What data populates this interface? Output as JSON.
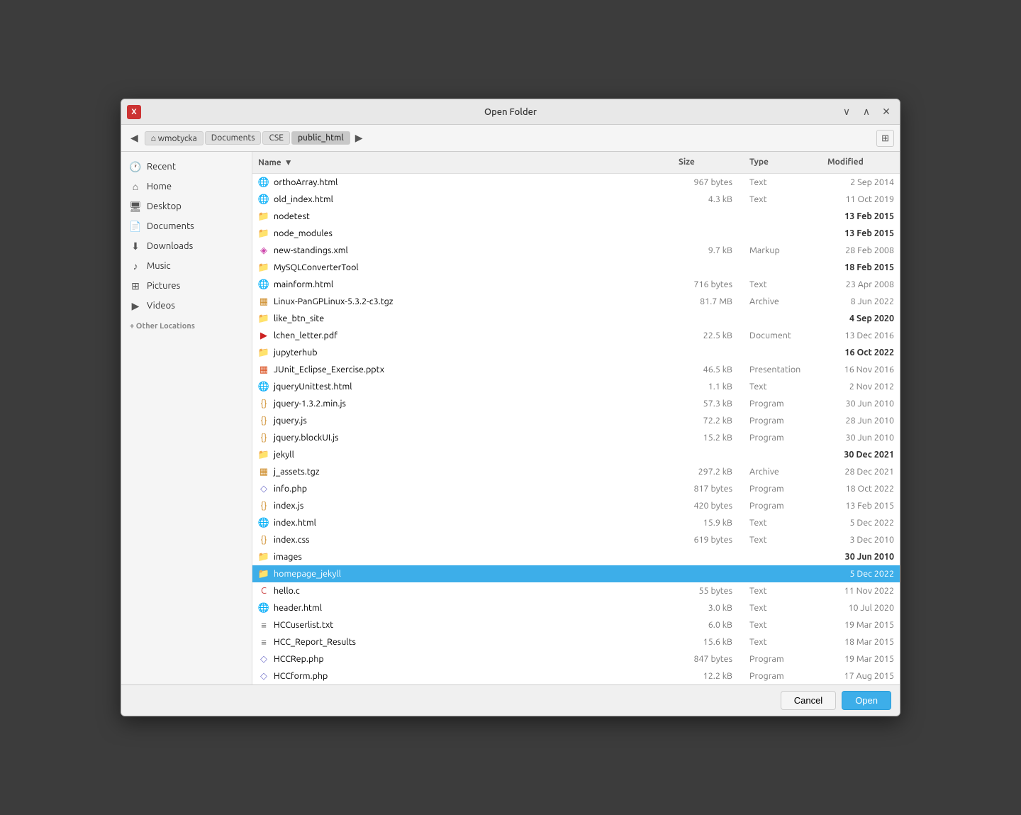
{
  "window": {
    "title": "Open Folder",
    "icon": "X"
  },
  "titlebar": {
    "minimize_label": "∨",
    "maximize_label": "∧",
    "close_label": "✕"
  },
  "toolbar": {
    "back_label": "◀",
    "breadcrumbs": [
      "wmotycka",
      "Documents",
      "CSE",
      "public_html"
    ],
    "forward_label": "▶",
    "newdir_label": "⊞"
  },
  "sidebar": {
    "items": [
      {
        "id": "recent",
        "label": "Recent",
        "icon": "🕐"
      },
      {
        "id": "home",
        "label": "Home",
        "icon": "⌂"
      },
      {
        "id": "desktop",
        "label": "Desktop",
        "icon": "📋"
      },
      {
        "id": "documents",
        "label": "Documents",
        "icon": "📄"
      },
      {
        "id": "downloads",
        "label": "Downloads",
        "icon": "⬇"
      },
      {
        "id": "music",
        "label": "Music",
        "icon": "♪"
      },
      {
        "id": "pictures",
        "label": "Pictures",
        "icon": "⊞"
      },
      {
        "id": "videos",
        "label": "Videos",
        "icon": "▶"
      }
    ],
    "other_locations_label": "+ Other Locations"
  },
  "file_list": {
    "headers": {
      "name": "Name",
      "sort_icon": "▼",
      "size": "Size",
      "type": "Type",
      "modified": "Modified"
    },
    "files": [
      {
        "name": "orthoArray.html",
        "size": "967 bytes",
        "type": "Text",
        "modified": "2 Sep 2014",
        "icon": "🌐",
        "icon_class": "icon-html",
        "bold": false,
        "selected": false
      },
      {
        "name": "old_index.html",
        "size": "4.3 kB",
        "type": "Text",
        "modified": "11 Oct 2019",
        "icon": "🌐",
        "icon_class": "icon-html",
        "bold": false,
        "selected": false
      },
      {
        "name": "nodetest",
        "size": "",
        "type": "",
        "modified": "13 Feb 2015",
        "icon": "📁",
        "icon_class": "icon-folder",
        "bold": true,
        "selected": false
      },
      {
        "name": "node_modules",
        "size": "",
        "type": "",
        "modified": "13 Feb 2015",
        "icon": "📁",
        "icon_class": "icon-folder",
        "bold": true,
        "selected": false
      },
      {
        "name": "new-standings.xml",
        "size": "9.7 kB",
        "type": "Markup",
        "modified": "28 Feb 2008",
        "icon": "◈",
        "icon_class": "icon-xml",
        "bold": false,
        "selected": false
      },
      {
        "name": "MySQLConverterTool",
        "size": "",
        "type": "",
        "modified": "18 Feb 2015",
        "icon": "📁",
        "icon_class": "icon-folder",
        "bold": true,
        "selected": false
      },
      {
        "name": "mainform.html",
        "size": "716 bytes",
        "type": "Text",
        "modified": "23 Apr 2008",
        "icon": "🌐",
        "icon_class": "icon-html",
        "bold": false,
        "selected": false
      },
      {
        "name": "Linux-PanGPLinux-5.3.2-c3.tgz",
        "size": "81.7 MB",
        "type": "Archive",
        "modified": "8 Jun 2022",
        "icon": "▦",
        "icon_class": "icon-archive",
        "bold": false,
        "selected": false
      },
      {
        "name": "like_btn_site",
        "size": "",
        "type": "",
        "modified": "4 Sep 2020",
        "icon": "📁",
        "icon_class": "icon-folder",
        "bold": true,
        "selected": false
      },
      {
        "name": "lchen_letter.pdf",
        "size": "22.5 kB",
        "type": "Document",
        "modified": "13 Dec 2016",
        "icon": "▶",
        "icon_class": "icon-pdf",
        "bold": false,
        "selected": false
      },
      {
        "name": "jupyterhub",
        "size": "",
        "type": "",
        "modified": "16 Oct 2022",
        "icon": "📁",
        "icon_class": "icon-folder",
        "bold": true,
        "selected": false
      },
      {
        "name": "JUnit_Eclipse_Exercise.pptx",
        "size": "46.5 kB",
        "type": "Presentation",
        "modified": "16 Nov 2016",
        "icon": "▦",
        "icon_class": "icon-pptx",
        "bold": false,
        "selected": false
      },
      {
        "name": "jqueryUnittest.html",
        "size": "1.1 kB",
        "type": "Text",
        "modified": "2 Nov 2012",
        "icon": "🌐",
        "icon_class": "icon-html",
        "bold": false,
        "selected": false
      },
      {
        "name": "jquery-1.3.2.min.js",
        "size": "57.3 kB",
        "type": "Program",
        "modified": "30 Jun 2010",
        "icon": "{}",
        "icon_class": "icon-js",
        "bold": false,
        "selected": false
      },
      {
        "name": "jquery.js",
        "size": "72.2 kB",
        "type": "Program",
        "modified": "28 Jun 2010",
        "icon": "{}",
        "icon_class": "icon-js",
        "bold": false,
        "selected": false
      },
      {
        "name": "jquery.blockUI.js",
        "size": "15.2 kB",
        "type": "Program",
        "modified": "30 Jun 2010",
        "icon": "{}",
        "icon_class": "icon-js",
        "bold": false,
        "selected": false
      },
      {
        "name": "jekyll",
        "size": "",
        "type": "",
        "modified": "30 Dec 2021",
        "icon": "📁",
        "icon_class": "icon-folder",
        "bold": true,
        "selected": false
      },
      {
        "name": "j_assets.tgz",
        "size": "297.2 kB",
        "type": "Archive",
        "modified": "28 Dec 2021",
        "icon": "▦",
        "icon_class": "icon-archive",
        "bold": false,
        "selected": false
      },
      {
        "name": "info.php",
        "size": "817 bytes",
        "type": "Program",
        "modified": "18 Oct 2022",
        "icon": "◇",
        "icon_class": "icon-php",
        "bold": false,
        "selected": false
      },
      {
        "name": "index.js",
        "size": "420 bytes",
        "type": "Program",
        "modified": "13 Feb 2015",
        "icon": "{}",
        "icon_class": "icon-js",
        "bold": false,
        "selected": false
      },
      {
        "name": "index.html",
        "size": "15.9 kB",
        "type": "Text",
        "modified": "5 Dec 2022",
        "icon": "🌐",
        "icon_class": "icon-html",
        "bold": false,
        "selected": false
      },
      {
        "name": "index.css",
        "size": "619 bytes",
        "type": "Text",
        "modified": "3 Dec 2010",
        "icon": "{}",
        "icon_class": "icon-css",
        "bold": false,
        "selected": false
      },
      {
        "name": "images",
        "size": "",
        "type": "",
        "modified": "30 Jun 2010",
        "icon": "📁",
        "icon_class": "icon-folder",
        "bold": true,
        "selected": false
      },
      {
        "name": "homepage_jekyll",
        "size": "",
        "type": "",
        "modified": "5 Dec 2022",
        "icon": "📁",
        "icon_class": "icon-folder",
        "bold": false,
        "selected": true
      },
      {
        "name": "hello.c",
        "size": "55 bytes",
        "type": "Text",
        "modified": "11 Nov 2022",
        "icon": "C",
        "icon_class": "icon-c",
        "bold": false,
        "selected": false
      },
      {
        "name": "header.html",
        "size": "3.0 kB",
        "type": "Text",
        "modified": "10 Jul 2020",
        "icon": "🌐",
        "icon_class": "icon-html",
        "bold": false,
        "selected": false
      },
      {
        "name": "HCCuserlist.txt",
        "size": "6.0 kB",
        "type": "Text",
        "modified": "19 Mar 2015",
        "icon": "≡",
        "icon_class": "icon-txt",
        "bold": false,
        "selected": false
      },
      {
        "name": "HCC_Report_Results",
        "size": "15.6 kB",
        "type": "Text",
        "modified": "18 Mar 2015",
        "icon": "≡",
        "icon_class": "icon-txt",
        "bold": false,
        "selected": false
      },
      {
        "name": "HCCRep.php",
        "size": "847 bytes",
        "type": "Program",
        "modified": "19 Mar 2015",
        "icon": "◇",
        "icon_class": "icon-php",
        "bold": false,
        "selected": false
      },
      {
        "name": "HCCform.php",
        "size": "12.2 kB",
        "type": "Program",
        "modified": "17 Aug 2015",
        "icon": "◇",
        "icon_class": "icon-php",
        "bold": false,
        "selected": false
      }
    ]
  },
  "buttons": {
    "cancel": "Cancel",
    "open": "Open"
  }
}
